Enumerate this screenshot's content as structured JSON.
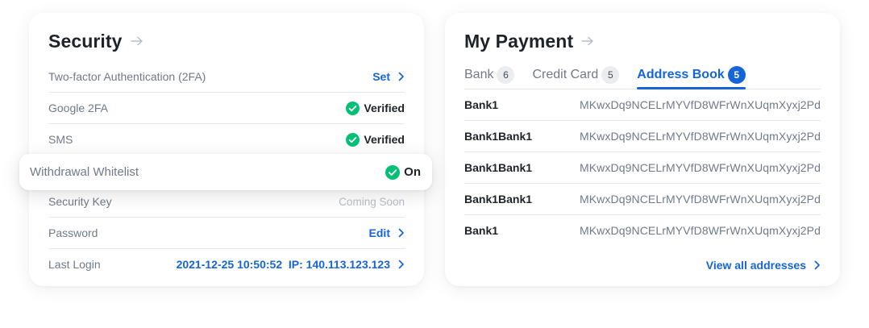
{
  "security": {
    "title": "Security",
    "rows": [
      {
        "label": "Two-factor Authentication (2FA)",
        "action": "Set"
      },
      {
        "label": "Google 2FA",
        "status": "Verified"
      },
      {
        "label": "SMS",
        "status": "Verified"
      },
      {
        "label": "Security Key",
        "status_text": "Coming Soon"
      },
      {
        "label": "Password",
        "action": "Edit"
      },
      {
        "label": "Last Login",
        "action": "2021-12-25 10:50:52  IP: 140.113.123.123"
      }
    ],
    "whitelist": {
      "label": "Withdrawal Whitelist",
      "status": "On"
    }
  },
  "payment": {
    "title": "My Payment",
    "tabs": [
      {
        "label": "Bank",
        "count": "6"
      },
      {
        "label": "Credit Card",
        "count": "5"
      },
      {
        "label": "Address Book",
        "count": "5"
      }
    ],
    "addresses": [
      {
        "name": "Bank1",
        "address": "MKwxDq9NCELrMYVfD8WFrWnXUqmXyxj2Pd"
      },
      {
        "name": "Bank1Bank1",
        "address": "MKwxDq9NCELrMYVfD8WFrWnXUqmXyxj2Pd"
      },
      {
        "name": "Bank1Bank1",
        "address": "MKwxDq9NCELrMYVfD8WFrWnXUqmXyxj2Pd"
      },
      {
        "name": "Bank1Bank1",
        "address": "MKwxDq9NCELrMYVfD8WFrWnXUqmXyxj2Pd"
      },
      {
        "name": "Bank1",
        "address": "MKwxDq9NCELrMYVfD8WFrWnXUqmXyxj2Pd"
      }
    ],
    "view_all": "View all addresses"
  },
  "colors": {
    "accent": "#1565d8",
    "success": "#02c076",
    "text": "#1e2329",
    "muted": "#707a8a"
  }
}
